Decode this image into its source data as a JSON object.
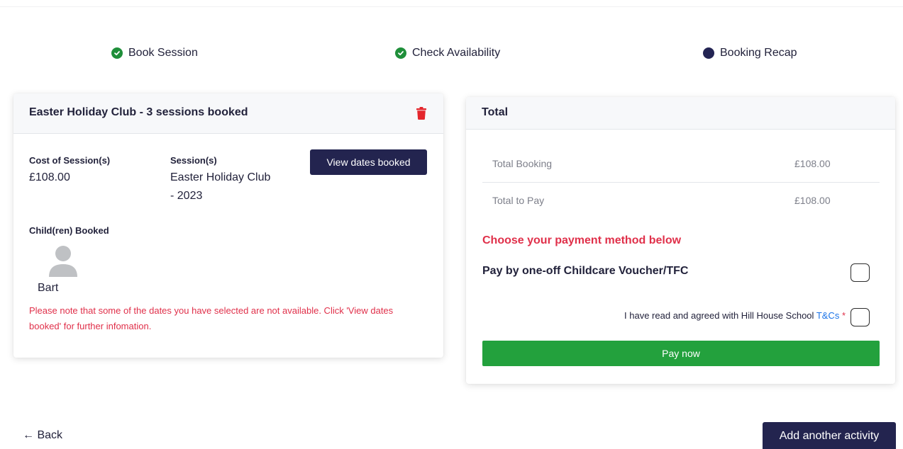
{
  "stepper": {
    "steps": [
      {
        "label": "Book Session",
        "status": "done"
      },
      {
        "label": "Check Availability",
        "status": "done"
      },
      {
        "label": "Booking Recap",
        "status": "current"
      }
    ]
  },
  "booking": {
    "title": "Easter Holiday Club - 3 sessions booked",
    "cost_label": "Cost of Session(s)",
    "cost_value": "£108.00",
    "sessions_label": "Session(s)",
    "sessions_value_line1": "Easter Holiday Club",
    "sessions_value_line2": "- 2023",
    "view_dates_button": "View dates booked",
    "children_label": "Child(ren) Booked",
    "child_name": "Bart",
    "note": "Please note that some of the dates you have selected are not available. Click 'View dates booked' for further infomation."
  },
  "total": {
    "title": "Total",
    "rows": [
      {
        "label": "Total Booking",
        "value": "£108.00"
      },
      {
        "label": "Total to Pay",
        "value": "£108.00"
      }
    ],
    "payment_heading": "Choose your payment method below",
    "payment_option": "Pay by one-off Childcare Voucher/TFC",
    "terms_text": "I have read and agreed with Hill House School",
    "terms_link": "T&Cs",
    "terms_required": "*",
    "pay_button": "Pay now"
  },
  "footer": {
    "back_label": "← Back",
    "add_button": "Add another activity"
  },
  "colors": {
    "primary_dark": "#23244f",
    "success": "#23a13d",
    "danger": "#e0304a",
    "link": "#1a73e8"
  }
}
